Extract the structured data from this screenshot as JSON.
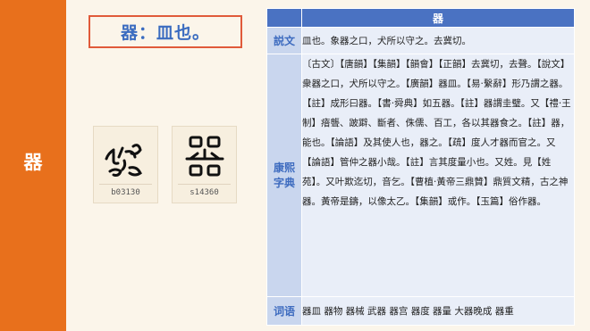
{
  "side": {
    "character": "器",
    "band_color": "#e8701c"
  },
  "definition": {
    "text": "器：皿也。"
  },
  "glyphs": [
    {
      "id": "b03130"
    },
    {
      "id": "s14360"
    }
  ],
  "table": {
    "header_char": "器",
    "rows": {
      "shuowen": {
        "label": "説文",
        "text": "皿也。象器之口，犬所以守之。去冀切。"
      },
      "kangxi": {
        "label_line1": "康熙",
        "label_line2": "字典",
        "text": "〔古文〕【唐韻】【集韻】【韻會】【正韻】去冀切，去聲。【說文】衆器之口，犬所以守之。【廣韻】器皿。【易·繫辭】形乃謂之器。【註】成形曰器。【書·舜典】如五器。【註】器謂圭璧。又【禮·王制】瘖聾、跛躃、斷者、侏儒、百工，各以其器食之。【註】器，能也。【論語】及其使人也，器之。【疏】度人才器而官之。又【論語】管仲之器小哉。【註】言其度量小也。又姓。見【姓苑】。又叶欺迄切，音乞。【曹植·黃帝三鼎贊】鼎質文精，古之神器。黃帝是鑄，以像太乙。【集韻】或作。【玉篇】俗作器。"
      },
      "ciyu": {
        "label": "词语",
        "text": "器皿 器物 器械 武器 器宫 器度 器量 大器晚成 器重"
      }
    }
  },
  "colors": {
    "header_blue": "#4a72c2",
    "label_bg": "#c9d6ee",
    "body_bg": "#e9eef8",
    "definition_border": "#e05a3a",
    "definition_text": "#3b6cc0"
  }
}
